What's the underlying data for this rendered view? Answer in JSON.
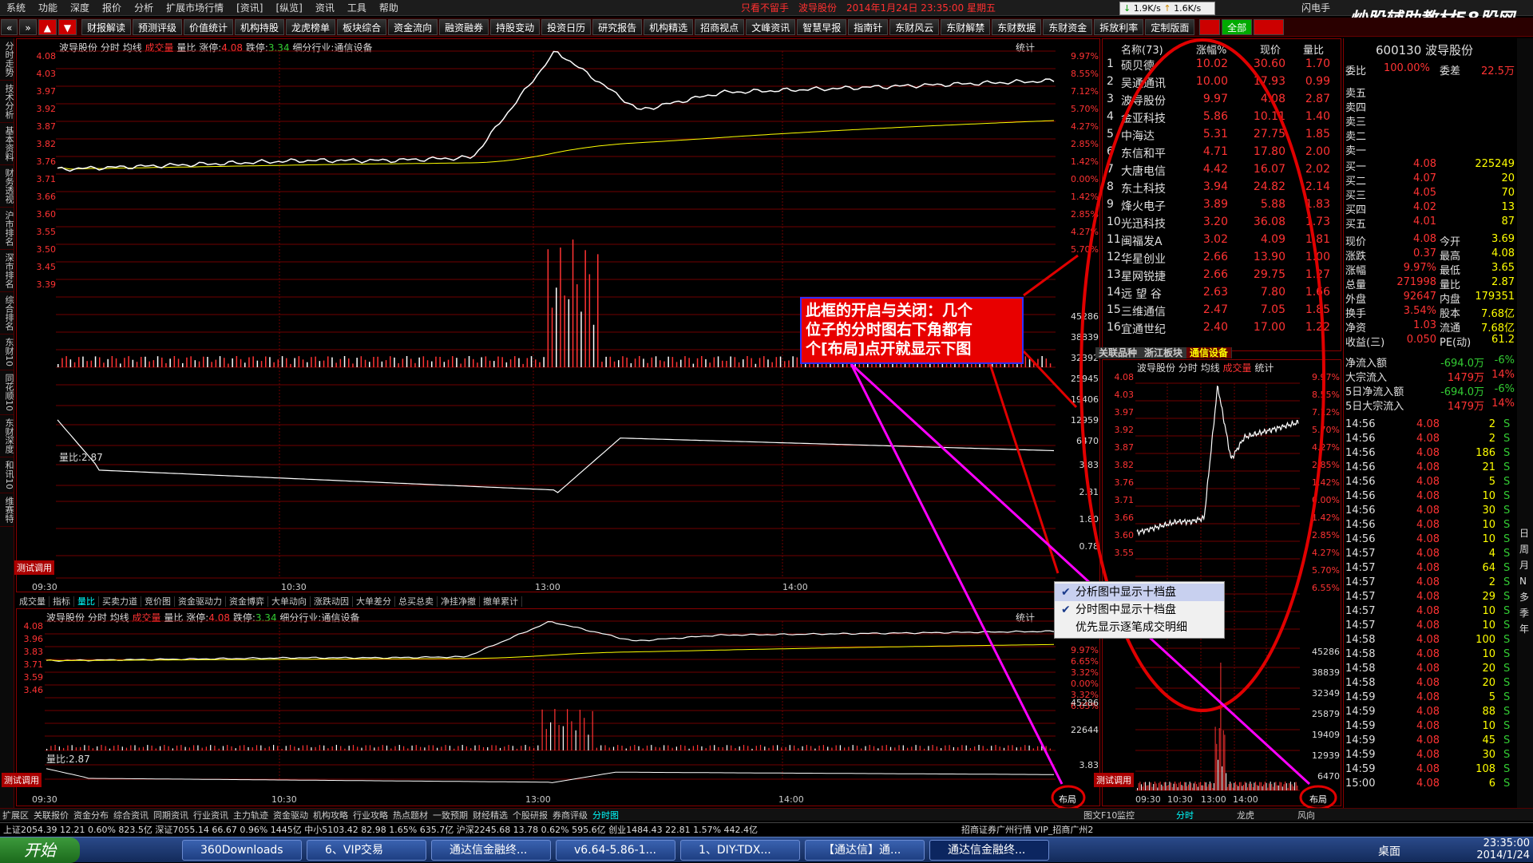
{
  "menu": [
    "系统",
    "功能",
    "深度",
    "报价",
    "分析",
    "扩展市场行情",
    "[资讯]",
    "[纵览]",
    "资讯",
    "工具",
    "帮助"
  ],
  "title_bar": {
    "text": "只看不留手　波导股份　2014年1月24日 23:35:00 星期五",
    "right": "闪电手"
  },
  "net_speed": {
    "down": "1.9K/s",
    "up": "1.6K/s"
  },
  "watermark": {
    "main": "炒股辅助教材58股网",
    "url": "www.58Gu.com"
  },
  "toolbar": [
    "财报解读",
    "预测评级",
    "价值统计",
    "机构持股",
    "龙虎榜单",
    "板块综合",
    "资金流向",
    "融资融券",
    "持股变动",
    "投资日历",
    "研究报告",
    "机构精选",
    "招商视点",
    "文峰资讯",
    "智慧早报",
    "指南针",
    "东财风云",
    "东财解禁",
    "东财数据",
    "东财资金",
    "拆放利率",
    "定制版面"
  ],
  "toolbar_right": [
    "全部"
  ],
  "left_tabs": [
    "分时走势",
    "技术分析",
    "基本资料",
    "财务透视",
    "沪市排名",
    "深市排名",
    "综合排名",
    "东财10",
    "同花顺10",
    "东财深度",
    "和讯10",
    "维赛特"
  ],
  "main_chart": {
    "header": {
      "name": "波导股份",
      "mode": "分时",
      "avg": "均线",
      "vol": "成交量",
      "ratio": "量比",
      "up_label": "涨停:",
      "up_val": "4.08",
      "down_label": "跌停:",
      "down_val": "3.34",
      "industry": "细分行业:通信设备"
    },
    "stat_label": "统计",
    "prices_left": [
      "4.08",
      "4.03",
      "3.97",
      "3.92",
      "3.87",
      "3.82",
      "3.76",
      "3.71",
      "3.66",
      "3.60",
      "3.55",
      "3.50",
      "3.45",
      "3.39"
    ],
    "pct_right": [
      "9.97%",
      "8.55%",
      "7.12%",
      "5.70%",
      "4.27%",
      "2.85%",
      "1.42%",
      "0.00%",
      "1.42%",
      "2.85%",
      "4.27%",
      "5.70%"
    ],
    "vol_right": [
      "45286",
      "38839",
      "32392",
      "25945",
      "19406",
      "12959",
      "6470"
    ],
    "ratio_label": "量比:2.87",
    "ratio_right": [
      "3.83",
      "2.81",
      "1.80",
      "0.78"
    ],
    "test_btn": "测试调用",
    "times": [
      "09:30",
      "10:30",
      "13:00",
      "14:00"
    ]
  },
  "chart_data": {
    "type": "line",
    "x": [
      "09:30",
      "10:00",
      "10:30",
      "11:00",
      "11:30",
      "13:00",
      "13:05",
      "13:10",
      "13:20",
      "13:30",
      "14:00",
      "14:30",
      "15:00"
    ],
    "series": [
      {
        "name": "价格",
        "values": [
          3.68,
          3.69,
          3.7,
          3.71,
          3.71,
          3.72,
          4.08,
          3.88,
          3.94,
          3.95,
          3.96,
          3.97,
          3.98
        ]
      }
    ],
    "ylim": [
      3.34,
      4.08
    ]
  },
  "sub_tabs": [
    "成交量",
    "指标",
    "量比",
    "买卖力道",
    "竞价图",
    "资金驱动力",
    "资金博弈",
    "大单动向",
    "涨跌动因",
    "大单差分",
    "总买总卖",
    "净挂净撤",
    "撤单累计"
  ],
  "lower_chart": {
    "header": {
      "name": "波导股份",
      "mode": "分时",
      "avg": "均线",
      "vol": "成交量",
      "ratio": "量比",
      "up_label": "涨停:",
      "up_val": "4.08",
      "down_label": "跌停:",
      "down_val": "3.34",
      "industry": "细分行业:通信设备"
    },
    "stat_label": "统计",
    "prices_left": [
      "4.08",
      "3.96",
      "3.83",
      "3.71",
      "3.59",
      "3.46"
    ],
    "pct_right": [
      "9.97%",
      "6.65%",
      "3.32%",
      "0.00%",
      "3.32%",
      "6.65%"
    ],
    "vol_right": [
      "45286",
      "22644"
    ],
    "ratio_label": "量比:2.87",
    "ratio_right": [
      "3.83"
    ],
    "test_btn": "测试调用",
    "layout_btn": "布局",
    "times": [
      "09:30",
      "10:30",
      "13:00",
      "14:00"
    ]
  },
  "rank": {
    "header": {
      "name": "名称(73)",
      "pct": "涨幅%",
      "price": "现价",
      "ratio": "量比"
    },
    "rows": [
      {
        "no": "1",
        "name": "硕贝德",
        "pct": "10.02",
        "price": "30.60",
        "ratio": "1.70"
      },
      {
        "no": "2",
        "name": "吴通通讯",
        "pct": "10.00",
        "price": "17.93",
        "ratio": "0.99"
      },
      {
        "no": "3",
        "name": "波导股份",
        "pct": "9.97",
        "price": "4.08",
        "ratio": "2.87"
      },
      {
        "no": "4",
        "name": "金亚科技",
        "pct": "5.86",
        "price": "10.11",
        "ratio": "1.40"
      },
      {
        "no": "5",
        "name": "中海达",
        "pct": "5.31",
        "price": "27.75",
        "ratio": "1.85"
      },
      {
        "no": "6",
        "name": "东信和平",
        "pct": "4.71",
        "price": "17.80",
        "ratio": "2.00"
      },
      {
        "no": "7",
        "name": "大唐电信",
        "pct": "4.42",
        "price": "16.07",
        "ratio": "2.02"
      },
      {
        "no": "8",
        "name": "东土科技",
        "pct": "3.94",
        "price": "24.82",
        "ratio": "2.14"
      },
      {
        "no": "9",
        "name": "烽火电子",
        "pct": "3.89",
        "price": "5.88",
        "ratio": "1.83"
      },
      {
        "no": "10",
        "name": "光迅科技",
        "pct": "3.20",
        "price": "36.08",
        "ratio": "1.73"
      },
      {
        "no": "11",
        "name": "闽福发A",
        "pct": "3.02",
        "price": "4.09",
        "ratio": "1.81"
      },
      {
        "no": "12",
        "name": "华星创业",
        "pct": "2.66",
        "price": "13.90",
        "ratio": "1.00"
      },
      {
        "no": "13",
        "name": "星网锐捷",
        "pct": "2.66",
        "price": "29.75",
        "ratio": "1.27"
      },
      {
        "no": "14",
        "name": "远 望 谷",
        "pct": "2.63",
        "price": "7.80",
        "ratio": "1.66"
      },
      {
        "no": "15",
        "name": "三维通信",
        "pct": "2.47",
        "price": "7.05",
        "ratio": "1.85"
      },
      {
        "no": "16",
        "name": "宜通世纪",
        "pct": "2.40",
        "price": "17.00",
        "ratio": "1.22"
      }
    ],
    "tabs": [
      "关联品种",
      "浙江板块",
      "通信设备"
    ]
  },
  "mini_chart": {
    "header": {
      "name": "波导股份",
      "mode": "分时",
      "avg": "均线",
      "vol": "成交量",
      "stat": "统计"
    },
    "prices_left": [
      "4.08",
      "4.03",
      "3.97",
      "3.92",
      "3.87",
      "3.82",
      "3.76",
      "3.71",
      "3.66",
      "3.60",
      "3.55"
    ],
    "pct_right": [
      "9.97%",
      "8.55%",
      "7.12%",
      "5.70%",
      "4.27%",
      "2.85%",
      "1.42%",
      "0.00%",
      "1.42%",
      "2.85%",
      "4.27%",
      "5.70%",
      "6.55%"
    ],
    "vol_right": [
      "45286",
      "38839",
      "32349",
      "25879",
      "19409",
      "12939",
      "6470"
    ],
    "test_btn": "测试调用",
    "layout_btn": "布局",
    "times": [
      "09:30",
      "10:30",
      "13:00",
      "14:00"
    ]
  },
  "annotation": {
    "lines": [
      "此框的开启与关闭：几个",
      "位子的分时图右下角都有",
      "个[布局]点开就显示下图"
    ]
  },
  "context_menu": [
    {
      "label": "分析图中显示十档盘",
      "checked": "✔"
    },
    {
      "label": "分时图中显示十档盘",
      "checked": "✔"
    },
    {
      "label": "优先显示逐笔成交明细",
      "checked": ""
    }
  ],
  "quote": {
    "code_name": "600130 波导股份",
    "webi_label": "委比",
    "webi_val": "100.00%",
    "weicha_label": "委差",
    "weicha_val": "22.5万",
    "sell": [
      "卖五",
      "卖四",
      "卖三",
      "卖二",
      "卖一"
    ],
    "buy": [
      {
        "l": "买一",
        "p": "4.08",
        "v": "225249"
      },
      {
        "l": "买二",
        "p": "4.07",
        "v": "20"
      },
      {
        "l": "买三",
        "p": "4.05",
        "v": "70"
      },
      {
        "l": "买四",
        "p": "4.02",
        "v": "13"
      },
      {
        "l": "买五",
        "p": "4.01",
        "v": "87"
      }
    ],
    "stats": [
      {
        "l1": "现价",
        "v1": "4.08",
        "l2": "今开",
        "v2": "3.69"
      },
      {
        "l1": "涨跌",
        "v1": "0.37",
        "l2": "最高",
        "v2": "4.08"
      },
      {
        "l1": "涨幅",
        "v1": "9.97%",
        "l2": "最低",
        "v2": "3.65"
      },
      {
        "l1": "总量",
        "v1": "271998",
        "l2": "量比",
        "v2": "2.87"
      },
      {
        "l1": "外盘",
        "v1": "92647",
        "l2": "内盘",
        "v2": "179351"
      },
      {
        "l1": "换手",
        "v1": "3.54%",
        "l2": "股本",
        "v2": "7.68亿"
      },
      {
        "l1": "净资",
        "v1": "1.03",
        "l2": "流通",
        "v2": "7.68亿"
      },
      {
        "l1": "收益(三)",
        "v1": "0.050",
        "l2": "PE(动)",
        "v2": "61.2"
      }
    ],
    "flows": [
      {
        "l": "净流入额",
        "v": "-694.0万",
        "p": "-6%"
      },
      {
        "l": "大宗流入",
        "v": "1479万",
        "p": "14%"
      },
      {
        "l": "5日净流入额",
        "v": "-694.0万",
        "p": "-6%"
      },
      {
        "l": "5日大宗流入",
        "v": "1479万",
        "p": "14%"
      }
    ],
    "ticks": [
      {
        "t": "14:56",
        "p": "4.08",
        "v": "2",
        "s": "S"
      },
      {
        "t": "14:56",
        "p": "4.08",
        "v": "2",
        "s": "S"
      },
      {
        "t": "14:56",
        "p": "4.08",
        "v": "186",
        "s": "S"
      },
      {
        "t": "14:56",
        "p": "4.08",
        "v": "21",
        "s": "S"
      },
      {
        "t": "14:56",
        "p": "4.08",
        "v": "5",
        "s": "S"
      },
      {
        "t": "14:56",
        "p": "4.08",
        "v": "10",
        "s": "S"
      },
      {
        "t": "14:56",
        "p": "4.08",
        "v": "30",
        "s": "S"
      },
      {
        "t": "14:56",
        "p": "4.08",
        "v": "10",
        "s": "S"
      },
      {
        "t": "14:56",
        "p": "4.08",
        "v": "10",
        "s": "S"
      },
      {
        "t": "14:57",
        "p": "4.08",
        "v": "4",
        "s": "S"
      },
      {
        "t": "14:57",
        "p": "4.08",
        "v": "64",
        "s": "S"
      },
      {
        "t": "14:57",
        "p": "4.08",
        "v": "2",
        "s": "S"
      },
      {
        "t": "14:57",
        "p": "4.08",
        "v": "29",
        "s": "S"
      },
      {
        "t": "14:57",
        "p": "4.08",
        "v": "10",
        "s": "S"
      },
      {
        "t": "14:57",
        "p": "4.08",
        "v": "10",
        "s": "S"
      },
      {
        "t": "14:58",
        "p": "4.08",
        "v": "100",
        "s": "S"
      },
      {
        "t": "14:58",
        "p": "4.08",
        "v": "10",
        "s": "S"
      },
      {
        "t": "14:58",
        "p": "4.08",
        "v": "20",
        "s": "S"
      },
      {
        "t": "14:58",
        "p": "4.08",
        "v": "20",
        "s": "S"
      },
      {
        "t": "14:59",
        "p": "4.08",
        "v": "5",
        "s": "S"
      },
      {
        "t": "14:59",
        "p": "4.08",
        "v": "88",
        "s": "S"
      },
      {
        "t": "14:59",
        "p": "4.08",
        "v": "10",
        "s": "S"
      },
      {
        "t": "14:59",
        "p": "4.08",
        "v": "45",
        "s": "S"
      },
      {
        "t": "14:59",
        "p": "4.08",
        "v": "30",
        "s": "S"
      },
      {
        "t": "14:59",
        "p": "4.08",
        "v": "108",
        "s": "S"
      },
      {
        "t": "15:00",
        "p": "4.08",
        "v": "6",
        "s": "S"
      }
    ],
    "bottom_tabs": [
      "笔",
      "价",
      "细",
      "盘",
      "势",
      "指",
      "值",
      "主"
    ]
  },
  "right_tools": [
    "日",
    "周",
    "月",
    "N",
    "多",
    "季",
    "年"
  ],
  "bottom_tabs": [
    "扩展区",
    "关联报价",
    "资金分布",
    "综合资讯",
    "同期资讯",
    "行业资讯",
    "主力轨迹",
    "资金驱动",
    "机构攻略",
    "行业攻略",
    "热点题材",
    "一致预期",
    "财经精选",
    "个股研报",
    "券商评级",
    "分时图"
  ],
  "bottom_tabs_right": [
    "图文F10",
    "监控",
    "分时",
    "龙虎",
    "风向"
  ],
  "statusbar": "上证2054.39 12.21 0.60% 823.5亿 深证7055.14 66.67 0.96% 1445亿 中小5103.42 82.98 1.65% 635.7亿 沪深2245.68 13.78 0.62% 595.6亿 创业1484.43 22.81 1.57% 442.4亿",
  "statusbar_right": "招商证券广州行情 VIP_招商广州2",
  "taskbar": {
    "start": "开始",
    "items": [
      "360Downloads",
      "6、VIP交易",
      "通达信金融终...",
      "v6.64-5.86-1...",
      "1、DIY-TDX...",
      "【通达信】通...",
      "通达信金融终..."
    ],
    "right": "桌面",
    "time": "23:35:00",
    "date": "2014/1/24"
  }
}
